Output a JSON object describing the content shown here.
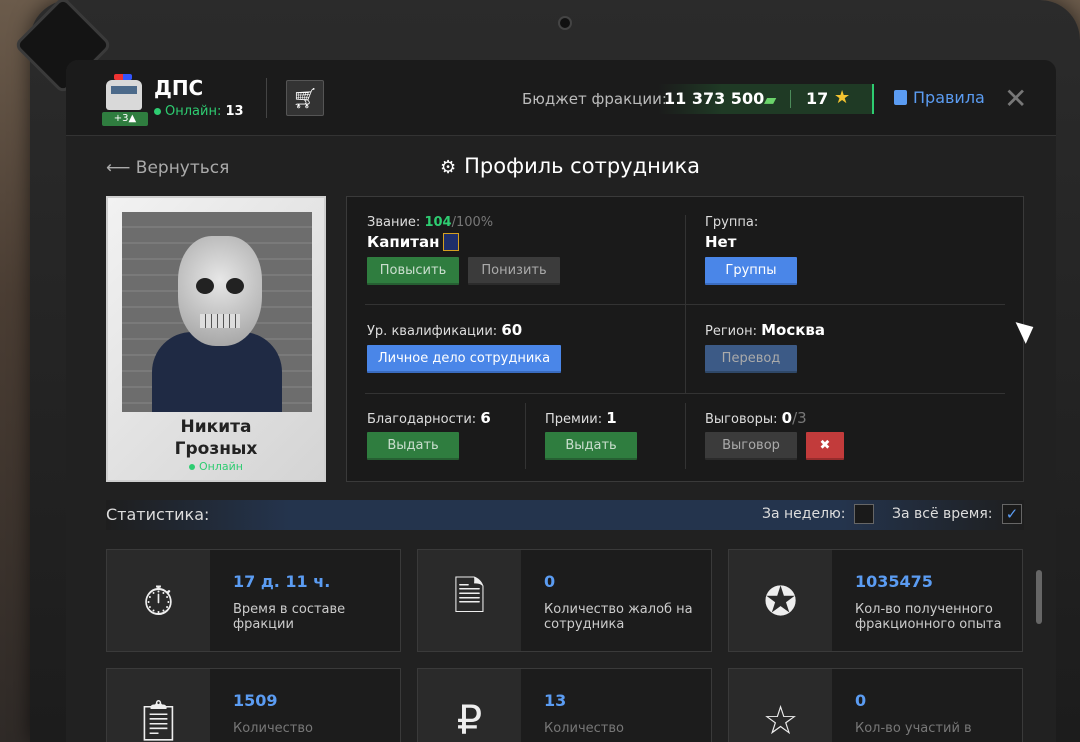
{
  "header": {
    "faction_name": "ДПС",
    "level_badge": "+3▲",
    "online_label": "Онлайн:",
    "online_count": "13",
    "shop_icon": "cart-icon",
    "budget_label": "Бюджет фракции:",
    "budget_value": "11 373 500",
    "stars_value": "17",
    "rules_label": "Правила"
  },
  "nav": {
    "back_label": "Вернуться",
    "page_title": "Профиль сотрудника"
  },
  "employee": {
    "first_name": "Никита",
    "last_name": "Грозных",
    "status": "Онлайн"
  },
  "profile": {
    "rank_label": "Звание:",
    "rank_percent": "104",
    "rank_max": "/100%",
    "rank_name": "Капитан",
    "promote_button": "Повысить",
    "demote_button": "Понизить",
    "group_label": "Группа:",
    "group_value": "Нет",
    "groups_button": "Группы",
    "qualification_label": "Ур. квалификации:",
    "qualification_value": "60",
    "personal_file_button": "Личное дело сотрудника",
    "region_label": "Регион:",
    "region_value": "Москва",
    "transfer_button": "Перевод",
    "thanks_label": "Благодарности:",
    "thanks_value": "6",
    "thanks_button": "Выдать",
    "bonus_label": "Премии:",
    "bonus_value": "1",
    "bonus_button": "Выдать",
    "reprimand_label": "Выговоры:",
    "reprimand_value": "0",
    "reprimand_max": "/3",
    "reprimand_button": "Выговор"
  },
  "stats": {
    "title": "Статистика:",
    "week_label": "За неделю:",
    "week_checked": false,
    "alltime_label": "За всё время:",
    "alltime_checked": true,
    "cards": [
      {
        "icon": "stopwatch-icon",
        "value": "17 д. 11 ч.",
        "label": "Время в составе фракции"
      },
      {
        "icon": "complaint-document-icon",
        "value": "0",
        "label": "Количество жалоб на сотрудника"
      },
      {
        "icon": "exp-stars-icon",
        "value": "1035475",
        "label": "Кол-во полученного фракционного опыта"
      },
      {
        "icon": "clipboard-checklist-icon",
        "value": "1509",
        "label": "Количество"
      },
      {
        "icon": "ruble-documents-icon",
        "value": "13",
        "label": "Количество"
      },
      {
        "icon": "star-podium-icon",
        "value": "0",
        "label": "Кол-во участий в"
      }
    ]
  },
  "colors": {
    "accent_blue": "#5b9cf2",
    "online_green": "#2ecc71",
    "button_green": "#2f7d3f",
    "button_red": "#c23b3b",
    "star_gold": "#f4c430"
  }
}
